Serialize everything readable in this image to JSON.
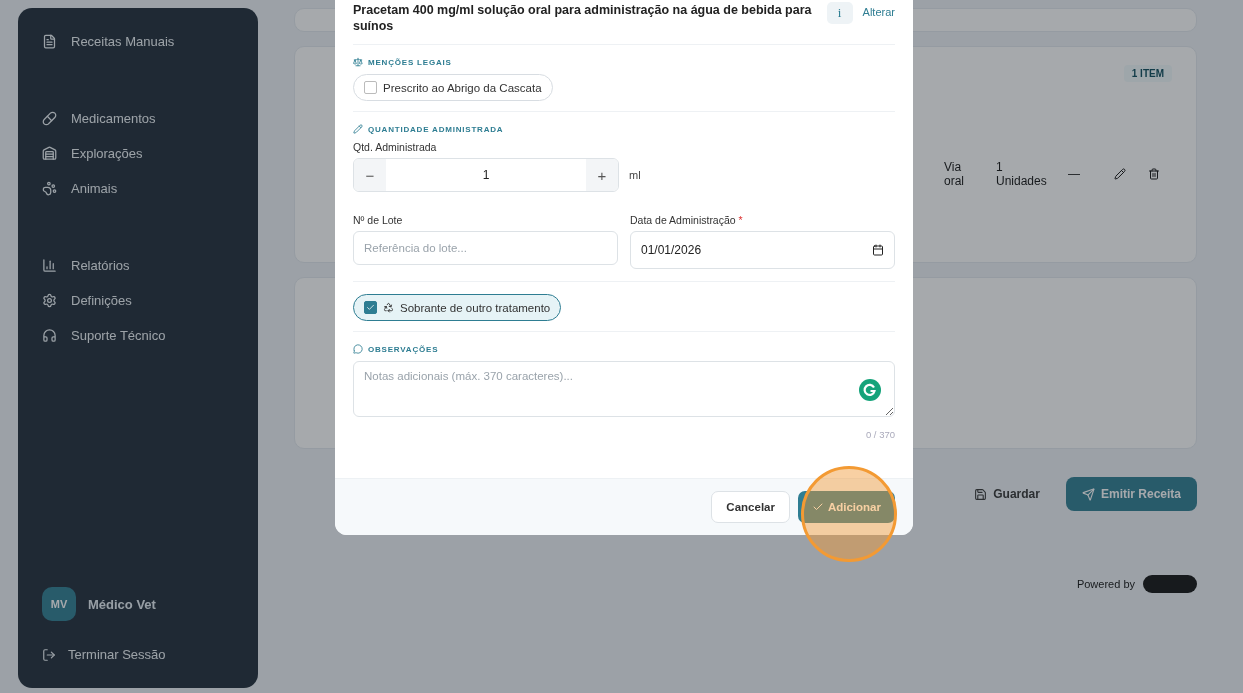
{
  "sidebar": {
    "items": [
      {
        "label": "Receitas Manuais",
        "selected": false
      },
      {
        "label": "Medicamentos",
        "selected": false
      },
      {
        "label": "Explorações",
        "selected": false
      },
      {
        "label": "Animais",
        "selected": false
      },
      {
        "label": "Relatórios",
        "selected": false
      },
      {
        "label": "Definições",
        "selected": false
      },
      {
        "label": "Suporte Técnico",
        "selected": false
      }
    ],
    "user": {
      "initials": "MV",
      "name": "Médico Vet"
    },
    "logout": "Terminar Sessão"
  },
  "background": {
    "badge": "1 ITEM",
    "row": [
      "Via oral",
      "1 Unidades",
      "—"
    ],
    "buttons": [
      "Guardar",
      "Emitir Receita"
    ],
    "powered_by": "Powered by"
  },
  "modal": {
    "title": "Pracetam 400 mg/ml solução oral para administração na água de bebida para suínos",
    "change_link": "Alterar",
    "info": "i",
    "legal": {
      "heading": "MENÇÕES LEGAIS",
      "option": {
        "label": "Prescrito ao Abrigo da Cascata",
        "checked": false
      }
    },
    "quantity": {
      "heading": "QUANTIDADE ADMINISTRADA",
      "label": "Qtd. Administrada",
      "minus": "−",
      "value": "1",
      "plus": "+",
      "unit": "ml"
    },
    "lot": {
      "label": "Nº de Lote",
      "placeholder": "Referência do lote..."
    },
    "date": {
      "label": "Data de Administração",
      "required": "*",
      "value": "01/01/2026"
    },
    "leftover": {
      "label": "Sobrante de outro tratamento",
      "checked": true
    },
    "notes": {
      "heading": "OBSERVAÇÕES",
      "placeholder": "Notas adicionais (máx. 370 caracteres)...",
      "counter": "0 / 370"
    },
    "buttons": {
      "cancel": "Cancelar",
      "confirm": "Adicionar"
    }
  }
}
